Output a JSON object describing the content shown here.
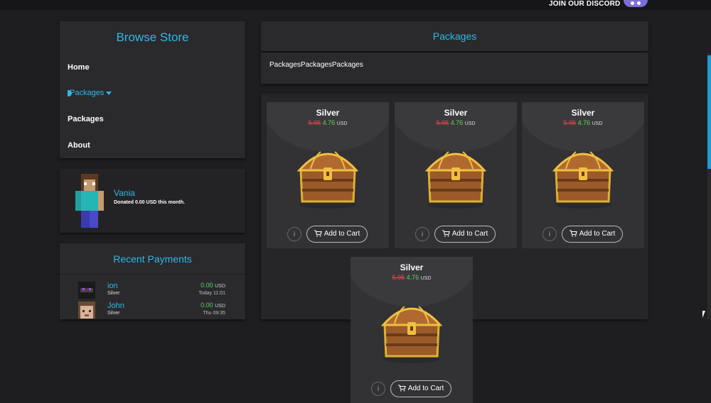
{
  "topbar": {
    "discord_label": "JOIN OUR DISCORD"
  },
  "sidebar": {
    "title": "Browse Store",
    "items": [
      {
        "label": "Home"
      },
      {
        "label": "Packages",
        "active": true
      },
      {
        "label": "Packages"
      },
      {
        "label": "About"
      }
    ]
  },
  "goal": {
    "name": "Vania",
    "text": "Donated 0.00 USD this month."
  },
  "payments": {
    "title": "Recent Payments",
    "rows": [
      {
        "name": "ion",
        "package": "Silver",
        "amount": "0.00",
        "currency": "USD",
        "time": "Today 11:01"
      },
      {
        "name": "John",
        "package": "Silver",
        "amount": "0.00",
        "currency": "USD",
        "time": "Thu 09:35"
      }
    ]
  },
  "packages": {
    "header": "Packages",
    "description": "PackagesPackagesPackages",
    "info_label": "i",
    "cart_label": "Add to Cart",
    "items": [
      {
        "name": "Silver",
        "old_price": "5.95",
        "price": "4.76",
        "currency": "USD"
      },
      {
        "name": "Silver",
        "old_price": "5.95",
        "price": "4.76",
        "currency": "USD"
      },
      {
        "name": "Silver",
        "old_price": "5.95",
        "price": "4.76",
        "currency": "USD"
      },
      {
        "name": "Silver",
        "old_price": "5.95",
        "price": "4.76",
        "currency": "USD"
      }
    ]
  },
  "colors": {
    "accent": "#2fb8e8",
    "price_new": "#5fd35f",
    "price_old": "#e64545",
    "background": "#1e1e20"
  }
}
